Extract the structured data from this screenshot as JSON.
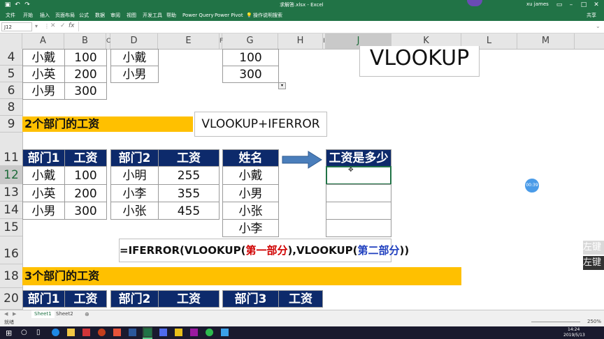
{
  "window": {
    "title": "求解答.xlsx - Excel",
    "user": "xu james"
  },
  "ribbon": {
    "tabs": [
      "文件",
      "开始",
      "插入",
      "页面布局",
      "公式",
      "数据",
      "审阅",
      "视图",
      "开发工具",
      "帮助",
      "Power Query",
      "Power Pivot",
      "操作说明搜索"
    ],
    "share": "共享"
  },
  "formula_bar": {
    "name_box": "J12"
  },
  "columns": [
    "A",
    "B",
    "C",
    "D",
    "E",
    "F",
    "G",
    "H",
    "I",
    "J",
    "K",
    "L",
    "M"
  ],
  "rows": [
    "4",
    "5",
    "6",
    "8",
    "9",
    "11",
    "12",
    "13",
    "14",
    "15",
    "16",
    "18",
    "20"
  ],
  "top_tables": {
    "ab": [
      [
        "小戴",
        "100"
      ],
      [
        "小英",
        "200"
      ],
      [
        "小男",
        "300"
      ]
    ],
    "d": [
      "小戴",
      "小男"
    ],
    "g": [
      "100",
      "300"
    ]
  },
  "vlookup_box": "VLOOKUP",
  "section1": {
    "title": "2个部门的工资",
    "box": "VLOOKUP+IFERROR"
  },
  "table1": {
    "headers": [
      "部门1",
      "工资"
    ],
    "rows": [
      [
        "小戴",
        "100"
      ],
      [
        "小英",
        "200"
      ],
      [
        "小男",
        "300"
      ]
    ]
  },
  "table2": {
    "headers": [
      "部门2",
      "工资"
    ],
    "rows": [
      [
        "小明",
        "255"
      ],
      [
        "小李",
        "355"
      ],
      [
        "小张",
        "455"
      ]
    ]
  },
  "table3": {
    "header": "姓名",
    "rows": [
      "小戴",
      "小男",
      "小张",
      "小李"
    ]
  },
  "table4": {
    "header": "工资是多少"
  },
  "formula": {
    "prefix": "=IFERROR(VLOOKUP(",
    "part1": "第一部分",
    "middle": "),VLOOKUP(",
    "part2": "第二部分",
    "suffix": "))"
  },
  "section2": {
    "title": "3个部门的工资"
  },
  "table5": {
    "headers": [
      "部门1",
      "工资"
    ]
  },
  "table6": {
    "headers": [
      "部门2",
      "工资"
    ]
  },
  "table7": {
    "headers": [
      "部门3",
      "工资"
    ]
  },
  "sheets": [
    "Sheet1",
    "Sheet2"
  ],
  "status": {
    "left": "就绪",
    "zoom": "250%"
  },
  "timer": "00:39",
  "side_labels": [
    "左键",
    "左键"
  ],
  "clock": {
    "time": "14:24",
    "date": "2019/5/13"
  },
  "colors": {
    "excel_green": "#217346",
    "header_navy": "#0d2a6b",
    "yellow": "#ffc000",
    "arrow": "#4a7ebb",
    "red": "#d00000",
    "blue": "#1f3fbf"
  }
}
